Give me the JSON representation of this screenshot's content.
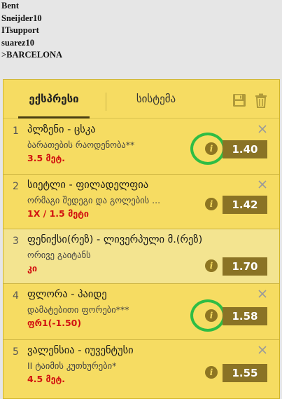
{
  "names": [
    "Bent",
    "Sneijder10",
    "ITsupport",
    "suarez10",
    ">BARCELONA"
  ],
  "tabs": {
    "express": "ექსპრესი",
    "system": "სისტემა"
  },
  "icons": {
    "save": "save-icon",
    "trash": "trash-icon",
    "close": "close-icon",
    "info": "info-icon",
    "info_glyph": "i"
  },
  "colors": {
    "slip_bg": "#f6dc62",
    "odds_bg": "#8a7325",
    "pick_text": "#d11010",
    "highlight_ring": "#2fbd44"
  },
  "bets": [
    {
      "number": "1",
      "match": "პლზენი - ცსკა",
      "market": "ბარათების რაოდენობა**",
      "pick": "3.5 მეტ.",
      "odds": "1.40",
      "highlighted": true
    },
    {
      "number": "2",
      "match": "სიეტლი - ფილადელფია",
      "market": "ორმაგი შედეგი და გოლების ...",
      "pick": "1X / 1.5 მეტი",
      "odds": "1.42",
      "highlighted": false
    },
    {
      "number": "3",
      "match": "ფენიქსი(რეზ) - ლივერპული მ.(რეზ)",
      "market": "ორივე გაიტანს",
      "pick": "კი",
      "odds": "1.70",
      "highlighted": false
    },
    {
      "number": "4",
      "match": "ფლორა - პაიდე",
      "market": "დამატებითი ფორები***",
      "pick": "ფრ1(-1.50)",
      "odds": "1.58",
      "highlighted": true
    },
    {
      "number": "5",
      "match": "ვალენსია - იუვენტუსი",
      "market": "II ტაიმის კუთხურები*",
      "pick": "4.5 მეტ.",
      "odds": "1.55",
      "highlighted": false
    }
  ]
}
